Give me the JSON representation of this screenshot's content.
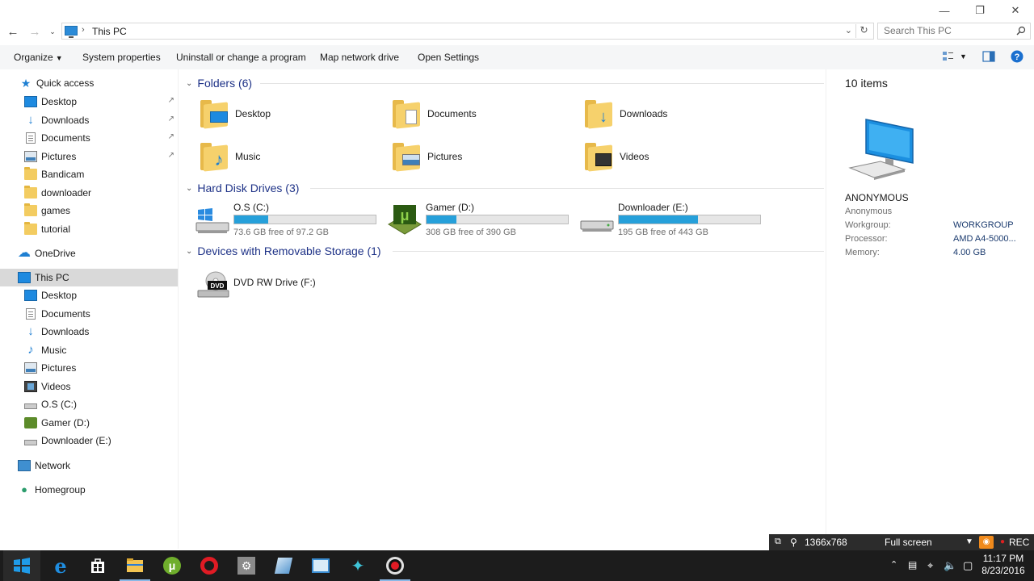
{
  "window": {
    "minimize_glyph": "—",
    "maximize_glyph": "❐",
    "close_glyph": "✕"
  },
  "address": {
    "path": "This PC",
    "search_placeholder": "Search This PC"
  },
  "toolbar": {
    "organize": "Organize",
    "system_properties": "System properties",
    "uninstall": "Uninstall or change a program",
    "map_drive": "Map network drive",
    "open_settings": "Open Settings"
  },
  "nav": {
    "quick_access": "Quick access",
    "qa_items": [
      {
        "label": "Desktop",
        "icon": "desktop-icon"
      },
      {
        "label": "Downloads",
        "icon": "downloads-icon"
      },
      {
        "label": "Documents",
        "icon": "documents-icon"
      },
      {
        "label": "Pictures",
        "icon": "pictures-icon"
      },
      {
        "label": "Bandicam",
        "icon": "folder-icon"
      },
      {
        "label": "downloader",
        "icon": "folder-icon"
      },
      {
        "label": "games",
        "icon": "folder-icon"
      },
      {
        "label": "tutorial",
        "icon": "folder-icon"
      }
    ],
    "onedrive": "OneDrive",
    "this_pc": "This PC",
    "pc_items": [
      {
        "label": "Desktop",
        "icon": "desktop-icon"
      },
      {
        "label": "Documents",
        "icon": "documents-icon"
      },
      {
        "label": "Downloads",
        "icon": "downloads-icon"
      },
      {
        "label": "Music",
        "icon": "music-icon"
      },
      {
        "label": "Pictures",
        "icon": "pictures-icon"
      },
      {
        "label": "Videos",
        "icon": "videos-icon"
      },
      {
        "label": "O.S (C:)",
        "icon": "windows-drive-icon"
      },
      {
        "label": "Gamer (D:)",
        "icon": "utorrent-drive-icon"
      },
      {
        "label": "Downloader (E:)",
        "icon": "drive-icon"
      }
    ],
    "network": "Network",
    "homegroup": "Homegroup"
  },
  "content": {
    "folders_header": "Folders (6)",
    "folders": [
      {
        "label": "Desktop"
      },
      {
        "label": "Documents"
      },
      {
        "label": "Downloads"
      },
      {
        "label": "Music"
      },
      {
        "label": "Pictures"
      },
      {
        "label": "Videos"
      }
    ],
    "drives_header": "Hard Disk Drives (3)",
    "drives": [
      {
        "name": "O.S (C:)",
        "free": "73.6 GB free of 97.2 GB",
        "used_fraction": 0.24
      },
      {
        "name": "Gamer (D:)",
        "free": "308 GB free of 390 GB",
        "used_fraction": 0.21
      },
      {
        "name": "Downloader (E:)",
        "free": "195 GB free of 443 GB",
        "used_fraction": 0.56
      }
    ],
    "removable_header": "Devices with Removable Storage (1)",
    "removable": [
      {
        "name": "DVD RW Drive (F:)",
        "badge": "DVD"
      }
    ]
  },
  "details": {
    "count": "10 items",
    "computer_name": "ANONYMOUS",
    "user": "Anonymous",
    "workgroup_label": "Workgroup:",
    "workgroup_value": "WORKGROUP",
    "processor_label": "Processor:",
    "processor_value": "AMD A4-5000...",
    "memory_label": "Memory:",
    "memory_value": "4.00 GB"
  },
  "recorder": {
    "resolution": "1366x768",
    "mode": "Full screen",
    "rec": "REC"
  },
  "taskbar": {
    "time": "11:17 PM",
    "date": "8/23/2016"
  },
  "colors": {
    "accent": "#26a0da",
    "header_blue": "#1e3287",
    "taskbar": "#1c1c1c"
  }
}
